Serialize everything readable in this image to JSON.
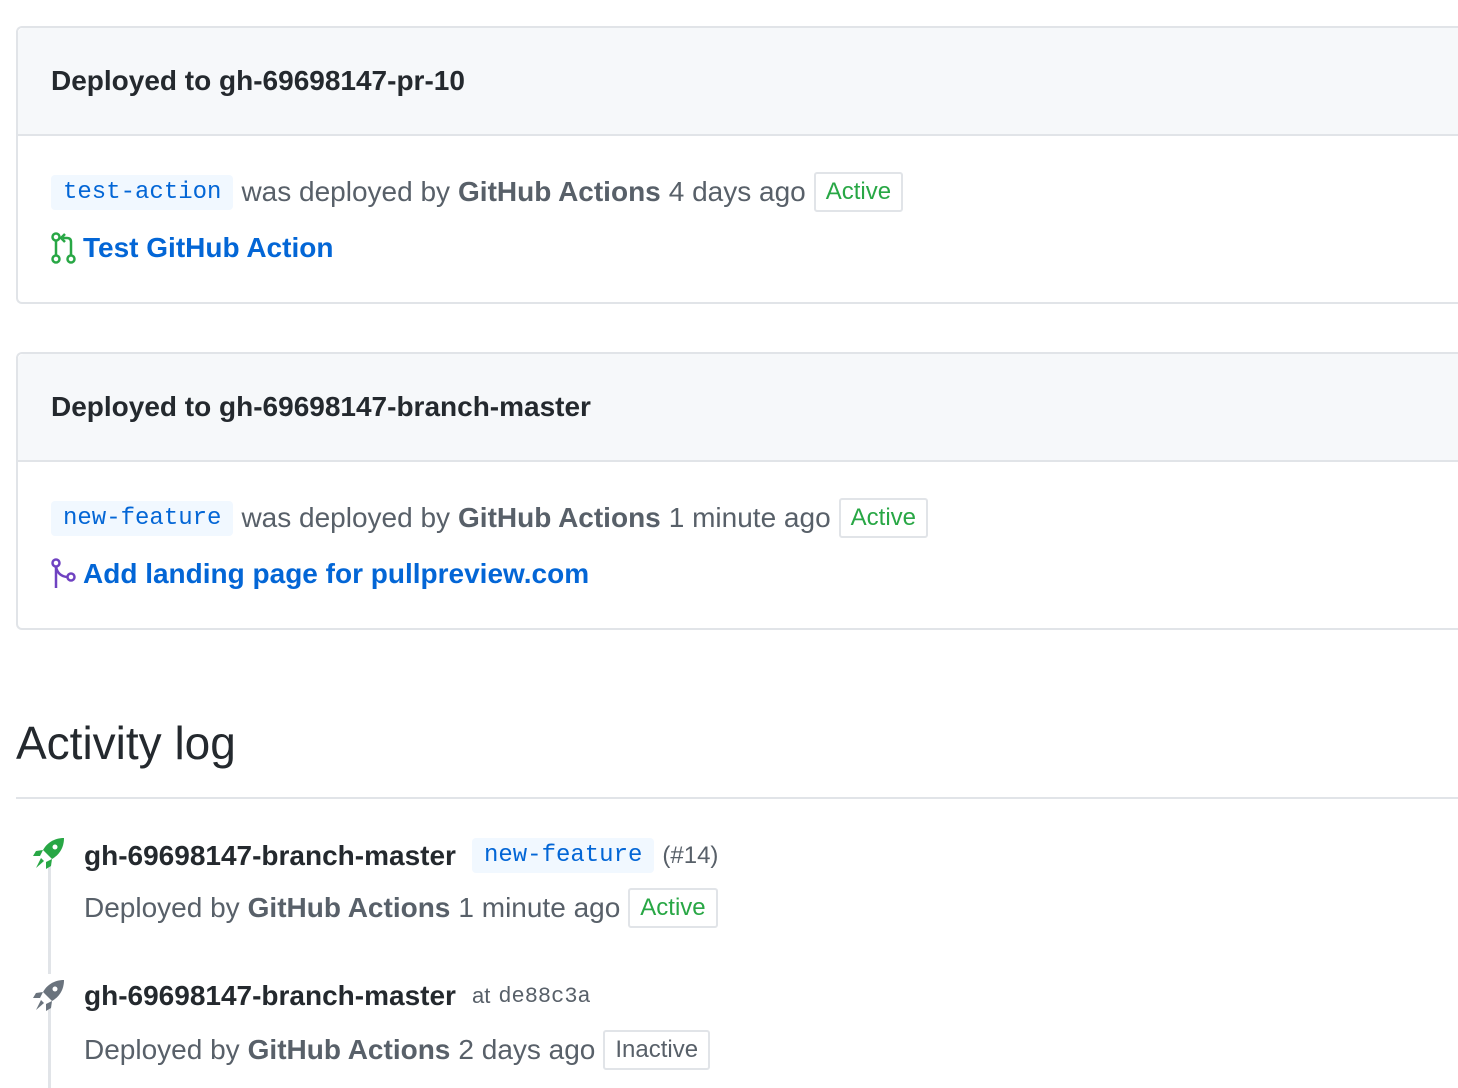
{
  "deployments": [
    {
      "title": "Deployed to gh-69698147-pr-10",
      "ref": "test-action",
      "deployed_by_prefix": "was deployed by",
      "actor": "GitHub Actions",
      "time": "4 days ago",
      "status": "Active",
      "link_icon": "pull-request-icon",
      "link_icon_color": "#28a745",
      "link_text": "Test GitHub Action"
    },
    {
      "title": "Deployed to gh-69698147-branch-master",
      "ref": "new-feature",
      "deployed_by_prefix": "was deployed by",
      "actor": "GitHub Actions",
      "time": "1 minute ago",
      "status": "Active",
      "link_icon": "merged-icon",
      "link_icon_color": "#6f42c1",
      "link_text": "Add landing page for pullpreview.com"
    }
  ],
  "activity_log": {
    "title": "Activity log",
    "entries": [
      {
        "icon": "rocket-icon",
        "icon_color": "#28a745",
        "environment": "gh-69698147-branch-master",
        "ref": "new-feature",
        "pr": "(#14)",
        "deployed_by_prefix": "Deployed by",
        "actor": "GitHub Actions",
        "time": "1 minute ago",
        "status": "Active"
      },
      {
        "icon": "rocket-icon",
        "icon_color": "#6a737d",
        "environment": "gh-69698147-branch-master",
        "at_label": "at",
        "sha": "de88c3a",
        "deployed_by_prefix": "Deployed by",
        "actor": "GitHub Actions",
        "time": "2 days ago",
        "status": "Inactive"
      }
    ]
  },
  "colors": {
    "link": "#0366d6",
    "active": "#28a745",
    "muted": "#586069",
    "border": "#e1e4e8"
  }
}
